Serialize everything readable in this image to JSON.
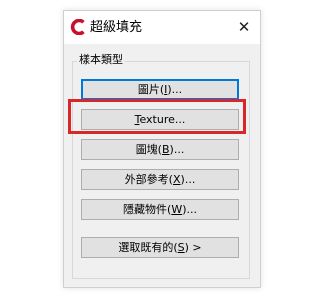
{
  "dialog": {
    "title": "超級填充",
    "close_glyph": "✕",
    "app_icon": "autocad-c-logo-icon",
    "accent_color": "#c8102e"
  },
  "group": {
    "label": "樣本類型"
  },
  "buttons": [
    {
      "pre": "圖片(",
      "key": "I",
      "post": ")...",
      "focused": true
    },
    {
      "pre": "",
      "key": "T",
      "post": "exture..."
    },
    {
      "pre": "圖塊(",
      "key": "B",
      "post": ")..."
    },
    {
      "pre": "外部參考(",
      "key": "X",
      "post": ")..."
    },
    {
      "pre": "隱藏物件(",
      "key": "W",
      "post": ")..."
    },
    {
      "pre": "選取既有的(",
      "key": "S",
      "post": ") >"
    }
  ],
  "highlight_color": "#d9262a"
}
